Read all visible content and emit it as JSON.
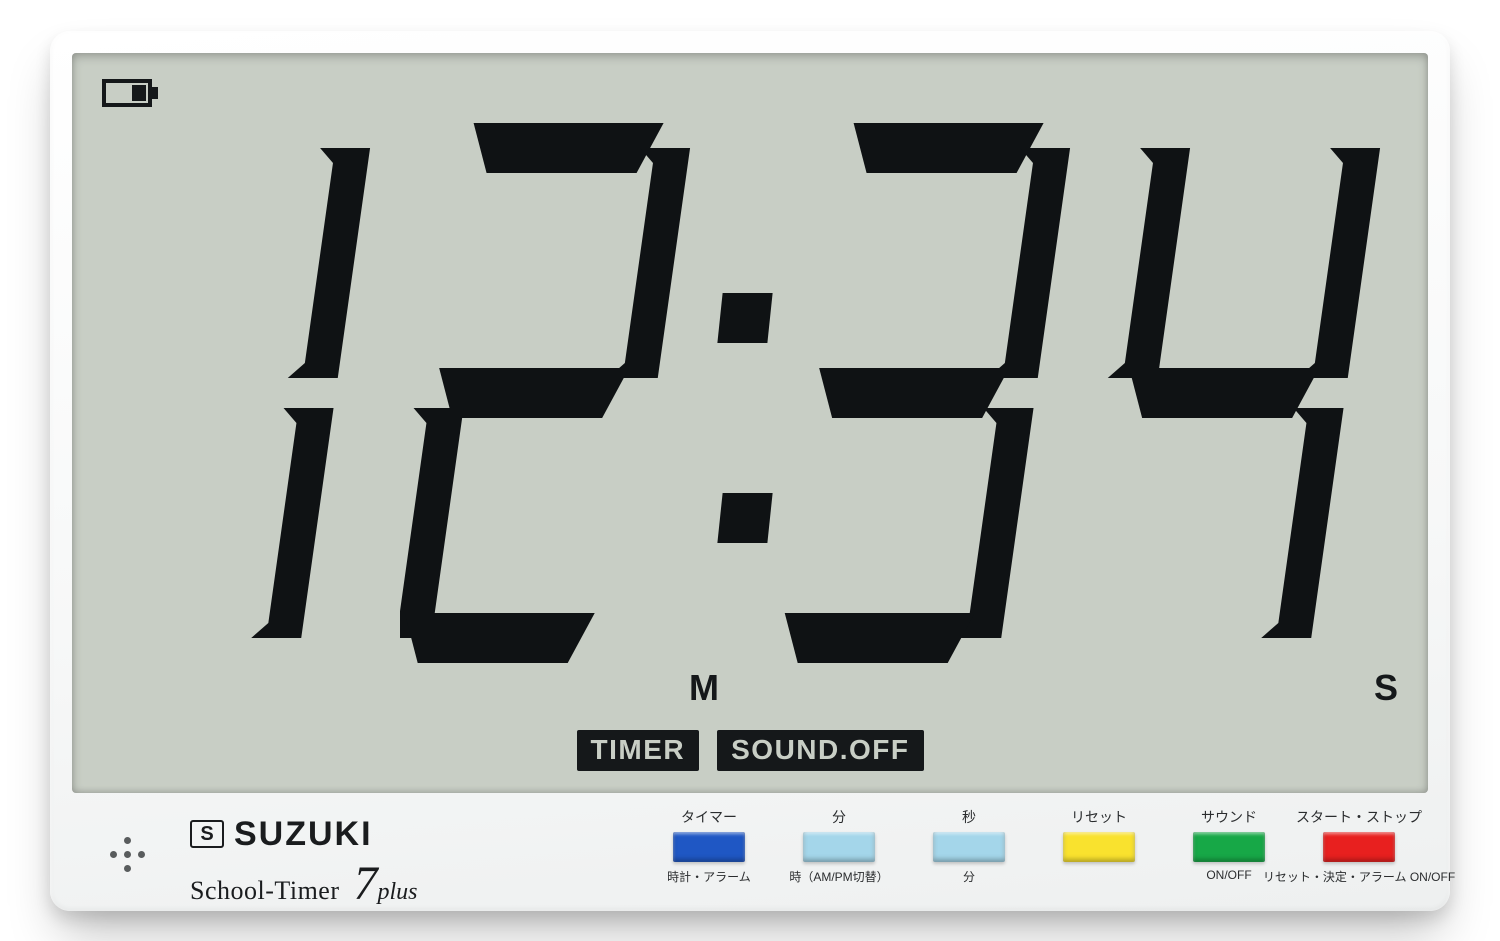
{
  "display": {
    "digits": "1234",
    "minutes_unit": "M",
    "seconds_unit": "S",
    "status_timer": "TIMER",
    "status_sound": "SOUND.OFF",
    "battery_visible": true
  },
  "brand": {
    "logo_letter": "S",
    "name": "SUZUKI",
    "product_line": "School-Timer",
    "product_number": "7",
    "product_suffix": "plus"
  },
  "buttons": [
    {
      "id": "timer",
      "top": "タイマー",
      "bottom": "時計・アラーム",
      "color": "#1f57c4"
    },
    {
      "id": "minute",
      "top": "分",
      "bottom": "時（AM/PM切替）",
      "color": "#a4d6ea"
    },
    {
      "id": "second",
      "top": "秒",
      "bottom": "分",
      "color": "#a4d6ea"
    },
    {
      "id": "reset",
      "top": "リセット",
      "bottom": "",
      "color": "#f9e22e"
    },
    {
      "id": "sound",
      "top": "サウンド",
      "bottom": "ON/OFF",
      "color": "#17a847"
    },
    {
      "id": "start",
      "top": "スタート・ストップ",
      "bottom": "リセット・決定・アラーム ON/OFF",
      "color": "#e8201f"
    }
  ]
}
